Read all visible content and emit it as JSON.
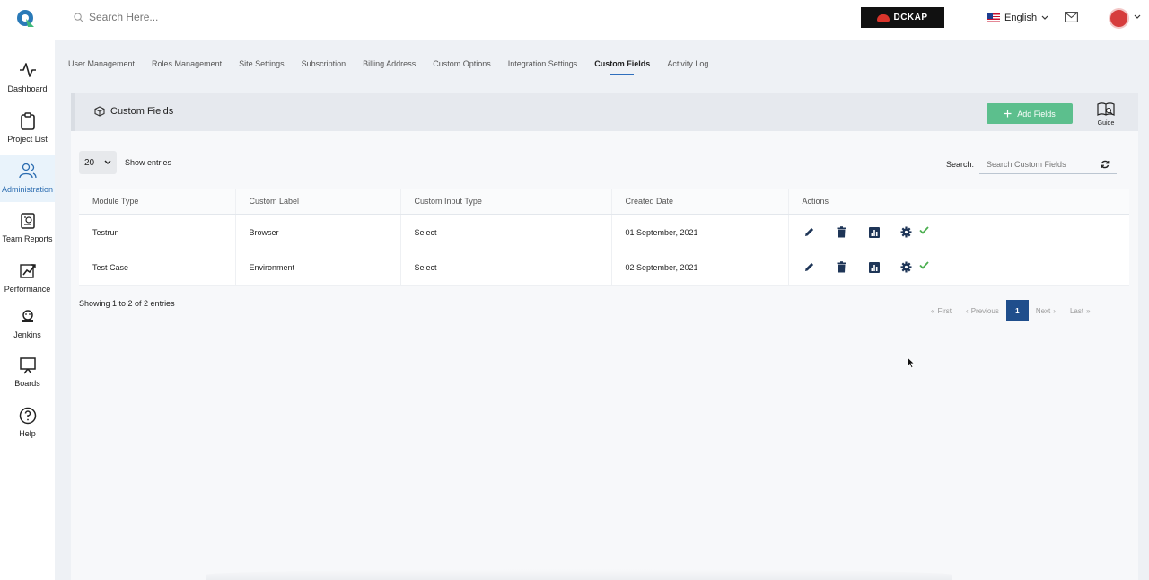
{
  "header": {
    "search_placeholder": "Search Here...",
    "brand_badge": "DCKAP",
    "language": "English"
  },
  "sidebar": {
    "items": [
      {
        "label": "Dashboard",
        "icon": "activity-icon"
      },
      {
        "label": "Project List",
        "icon": "clipboard-icon"
      },
      {
        "label": "Administration",
        "icon": "users-icon",
        "active": true
      },
      {
        "label": "Team Reports",
        "icon": "report-icon"
      },
      {
        "label": "Performance",
        "icon": "performance-icon"
      },
      {
        "label": "Jenkins",
        "icon": "jenkins-icon"
      },
      {
        "label": "Boards",
        "icon": "board-icon"
      },
      {
        "label": "Help",
        "icon": "help-icon"
      }
    ]
  },
  "tabs": [
    "User Management",
    "Roles Management",
    "Site Settings",
    "Subscription",
    "Billing Address",
    "Custom Options",
    "Integration Settings",
    "Custom Fields",
    "Activity Log"
  ],
  "active_tab": "Custom Fields",
  "card": {
    "title": "Custom Fields",
    "add_button": "Add Fields",
    "guide_label": "Guide",
    "entries_value": "20",
    "entries_label": "Show entries",
    "search_label": "Search:",
    "search_placeholder": "Search Custom Fields"
  },
  "table": {
    "headers": [
      "Module Type",
      "Custom Label",
      "Custom Input Type",
      "Created Date",
      "Actions"
    ],
    "rows": [
      {
        "module_type": "Testrun",
        "custom_label": "Browser",
        "input_type": "Select",
        "created": "01 September, 2021"
      },
      {
        "module_type": "Test Case",
        "custom_label": "Environment",
        "input_type": "Select",
        "created": "02 September, 2021"
      }
    ]
  },
  "footer": {
    "showing": "Showing 1 to 2 of 2 entries",
    "pager": {
      "first": "First",
      "previous": "Previous",
      "current": "1",
      "next": "Next",
      "last": "Last"
    }
  },
  "colors": {
    "accent": "#2f6fbd",
    "add_button": "#5cbf8d",
    "pager_active": "#1f4e8c",
    "action_icon": "#1e3557",
    "status_check": "#4caf50"
  }
}
